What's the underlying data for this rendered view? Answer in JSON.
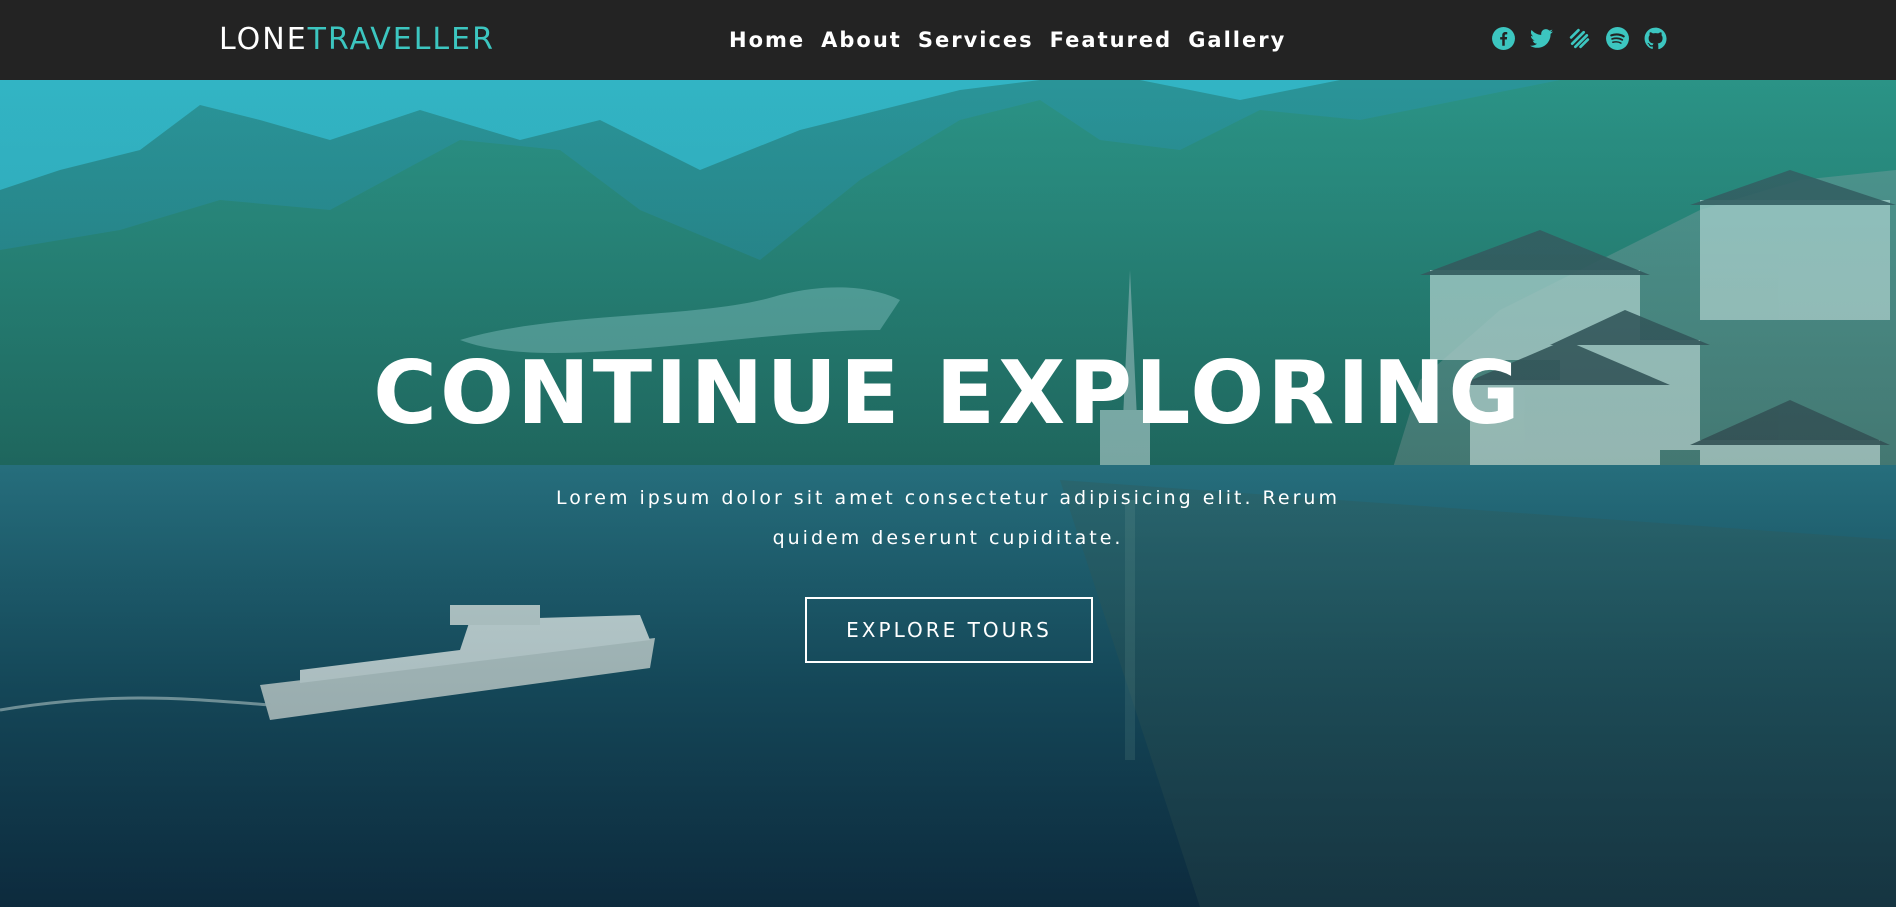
{
  "brand": {
    "part1": "LONE",
    "part2": "TRAVELLER",
    "accent_color": "#3cc6c0"
  },
  "nav": {
    "links": [
      "Home",
      "About",
      "Services",
      "Featured",
      "Gallery"
    ]
  },
  "socials": [
    {
      "icon": "facebook-icon"
    },
    {
      "icon": "twitter-icon"
    },
    {
      "icon": "squarespace-icon"
    },
    {
      "icon": "spotify-icon"
    },
    {
      "icon": "github-icon"
    }
  ],
  "hero": {
    "title": "CONTINUE EXPLORING",
    "subtitle": "Lorem ipsum dolor sit amet consectetur adipisicing elit. Rerum quidem deserunt cupiditate.",
    "button_label": "EXPLORE TOURS",
    "overlay_color": "#20aab9"
  }
}
